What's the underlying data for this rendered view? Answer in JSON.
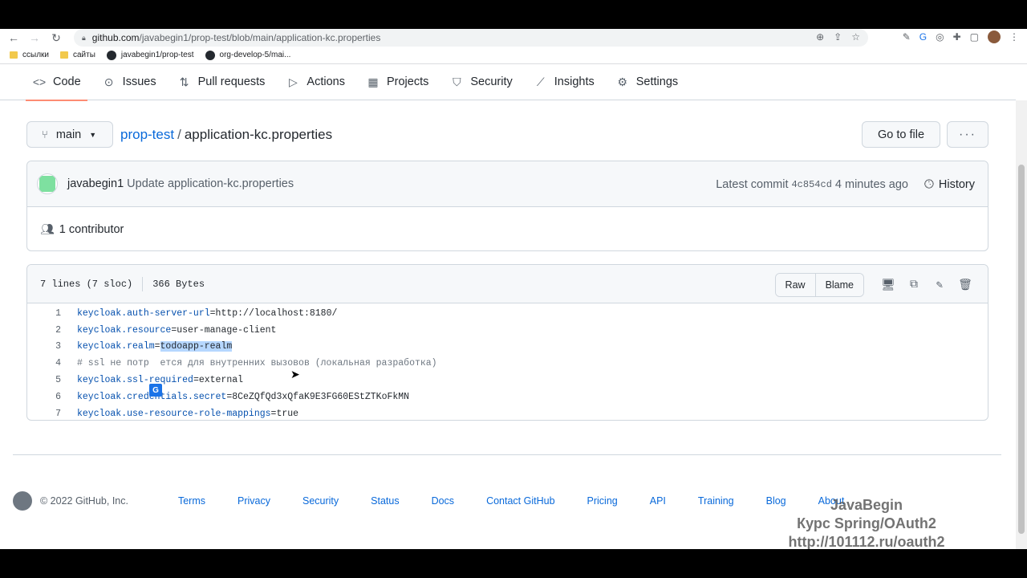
{
  "browser": {
    "url_host": "github.com",
    "url_path": "/javabegin1/prop-test/blob/main/application-kc.properties",
    "bookmarks": [
      {
        "label": "ссылки",
        "type": "folder"
      },
      {
        "label": "сайты",
        "type": "folder"
      },
      {
        "label": "javabegin1/prop-test",
        "type": "github"
      },
      {
        "label": "org-develop-5/mai...",
        "type": "github"
      }
    ]
  },
  "repo_nav": {
    "tabs": [
      {
        "label": "Code",
        "icon": "code-icon",
        "glyph": "<>"
      },
      {
        "label": "Issues",
        "icon": "issue-icon",
        "glyph": "⊙"
      },
      {
        "label": "Pull requests",
        "icon": "pull-request-icon",
        "glyph": "⇅"
      },
      {
        "label": "Actions",
        "icon": "play-icon",
        "glyph": "▷"
      },
      {
        "label": "Projects",
        "icon": "table-icon",
        "glyph": "▦"
      },
      {
        "label": "Security",
        "icon": "shield-icon",
        "glyph": "⛉"
      },
      {
        "label": "Insights",
        "icon": "graph-icon",
        "glyph": "⟋"
      },
      {
        "label": "Settings",
        "icon": "gear-icon",
        "glyph": "⚙"
      }
    ]
  },
  "file_header": {
    "branch": "main",
    "repo": "prop-test",
    "separator": "/",
    "filename": "application-kc.properties",
    "goto_label": "Go to file",
    "more_label": "···"
  },
  "commit": {
    "author": "javabegin1",
    "message": "Update application-kc.properties",
    "latest_label": "Latest commit",
    "sha": "4c854cd",
    "time": "4 minutes ago",
    "history_label": "History",
    "contributors": "1 contributor"
  },
  "file": {
    "lines_info": "7 lines (7 sloc)",
    "size": "366 Bytes",
    "raw_label": "Raw",
    "blame_label": "Blame",
    "lines": [
      {
        "n": "1",
        "key": "keycloak.auth-server-url",
        "val": "http://localhost:8180/"
      },
      {
        "n": "2",
        "key": "keycloak.resource",
        "val": "user-manage-client"
      },
      {
        "n": "3",
        "key": "keycloak.realm",
        "val": "todoapp-realm"
      },
      {
        "n": "4",
        "comment": "# ssl не потр  ется для внутренних вызовов (локальная разработка)"
      },
      {
        "n": "5",
        "key": "keycloak.ssl-required",
        "val": "external"
      },
      {
        "n": "6",
        "key": "keycloak.credentials.secret",
        "val": "8CeZQfQd3xQfaK9E3FG60EStZTKoFkMN"
      },
      {
        "n": "7",
        "key": "keycloak.use-resource-role-mappings",
        "val": "true"
      }
    ]
  },
  "footer": {
    "copyright": "© 2022 GitHub, Inc.",
    "links": [
      "Terms",
      "Privacy",
      "Security",
      "Status",
      "Docs",
      "Contact GitHub",
      "Pricing",
      "API",
      "Training",
      "Blog",
      "About"
    ]
  },
  "watermark": [
    "JavaBegin",
    "Курс Spring/OAuth2",
    "http://101112.ru/oauth2"
  ],
  "colors": {
    "accent": "#0969da",
    "tab_underline": "#fd8c73",
    "selection": "#b6d7ff"
  }
}
